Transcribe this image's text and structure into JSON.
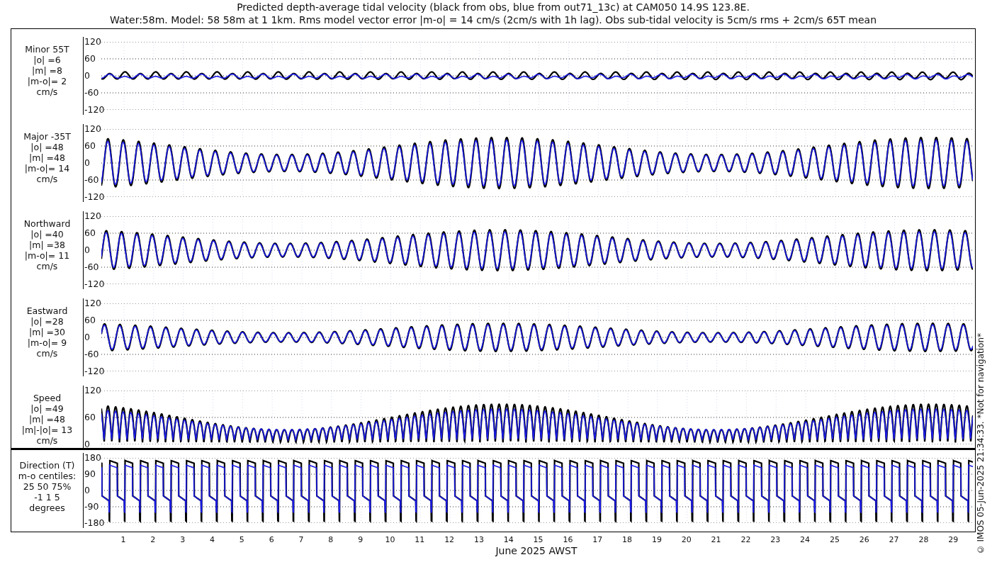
{
  "title_lines": [
    "Predicted depth-average tidal velocity (black from obs, blue from out71_13c) at CAM050 14.9S 123.8E.",
    "Water:58m. Model: 58 58m at 1 1km. Rms model vector error |m-o| = 14 cm/s (2cm/s with 1h lag). Obs sub-tidal velocity is 5cm/s rms + 2cm/s 65T mean"
  ],
  "panels": [
    {
      "kind": "signed",
      "label_lines": [
        "Minor 55T",
        "|o| =6",
        "|m| =8",
        "|m-o|= 2",
        "cm/s"
      ],
      "yticks": [
        "120",
        "60",
        "0",
        "-60",
        "-120"
      ]
    },
    {
      "kind": "signed",
      "label_lines": [
        "Major -35T",
        "|o| =48",
        "|m| =48",
        "|m-o|= 14",
        "cm/s"
      ],
      "yticks": [
        "120",
        "60",
        "0",
        "-60",
        "-120"
      ]
    },
    {
      "kind": "signed",
      "label_lines": [
        "Northward",
        "|o| =40",
        "|m| =38",
        "|m-o|= 11",
        "cm/s"
      ],
      "yticks": [
        "120",
        "60",
        "0",
        "-60",
        "-120"
      ]
    },
    {
      "kind": "signed",
      "label_lines": [
        "Eastward",
        "|o| =28",
        "|m| =30",
        "|m-o|= 9",
        "cm/s"
      ],
      "yticks": [
        "120",
        "60",
        "0",
        "-60",
        "-120"
      ]
    },
    {
      "kind": "speed",
      "label_lines": [
        "Speed",
        "|o| =49",
        "|m| =48",
        "|m|-|o|= 13",
        "cm/s"
      ],
      "yticks": [
        "120",
        "60",
        "0"
      ]
    }
  ],
  "direction_panel": {
    "label_lines": [
      "Direction (T)",
      "m-o centiles:",
      "25  50  75%",
      "-1  1  5",
      "degrees"
    ],
    "yticks": [
      "180",
      "90",
      "0",
      "-90",
      "-180"
    ]
  },
  "x_axis": {
    "ticks": [
      "1",
      "2",
      "3",
      "4",
      "5",
      "6",
      "7",
      "8",
      "9",
      "10",
      "11",
      "12",
      "13",
      "14",
      "15",
      "16",
      "17",
      "18",
      "19",
      "20",
      "21",
      "22",
      "23",
      "24",
      "25",
      "26",
      "27",
      "28",
      "29"
    ],
    "label": "June 2025 AWST"
  },
  "footer_note": "© IMOS 05-Jun-2025 21:34:33.  *Not for navigation*"
}
